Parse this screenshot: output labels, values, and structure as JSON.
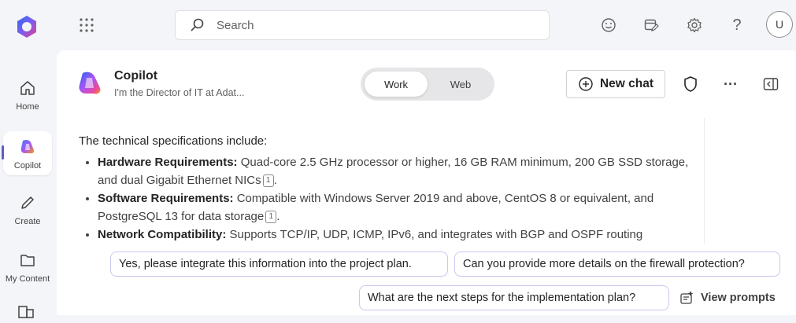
{
  "rail": {
    "items": [
      {
        "label": "Home",
        "icon": "home-icon"
      },
      {
        "label": "Copilot",
        "icon": "copilot-icon"
      },
      {
        "label": "Create",
        "icon": "pen-icon"
      },
      {
        "label": "My Content",
        "icon": "folder-icon"
      }
    ]
  },
  "topbar": {
    "search_placeholder": "Search",
    "avatar_initial": "U",
    "icons": [
      "waffle-icon",
      "smiley-icon",
      "calendar-edit-icon",
      "gear-icon",
      "help-icon"
    ]
  },
  "header": {
    "title": "Copilot",
    "subtitle": "I'm the Director of IT at Adat...",
    "toggle": {
      "work": "Work",
      "web": "Web",
      "selected": "Work"
    },
    "new_chat": "New chat"
  },
  "message": {
    "intro": "The technical specifications include:",
    "items": [
      {
        "label": "Hardware Requirements:",
        "text": " Quad-core 2.5 GHz processor or higher, 16 GB RAM minimum, 200 GB SSD storage, and dual Gigabit Ethernet NICs",
        "cite": "1",
        "end": "."
      },
      {
        "label": "Software Requirements:",
        "text": " Compatible with Windows Server 2019 and above, CentOS 8 or equivalent, and PostgreSQL 13 for data storage",
        "cite": "1",
        "end": "."
      },
      {
        "label": "Network Compatibility:",
        "text": " Supports TCP/IP, UDP, ICMP, IPv6, and integrates with BGP and OSPF routing",
        "cite": "",
        "end": ""
      }
    ]
  },
  "suggestions": [
    "Yes, please integrate this information into the project plan.",
    "Can you provide more details on the firewall protection?",
    "What are the next steps for the implementation plan?"
  ],
  "view_prompts": "View prompts",
  "colors": {
    "accent": "#5b5fc7",
    "chip_border": "#c7c8f0"
  }
}
